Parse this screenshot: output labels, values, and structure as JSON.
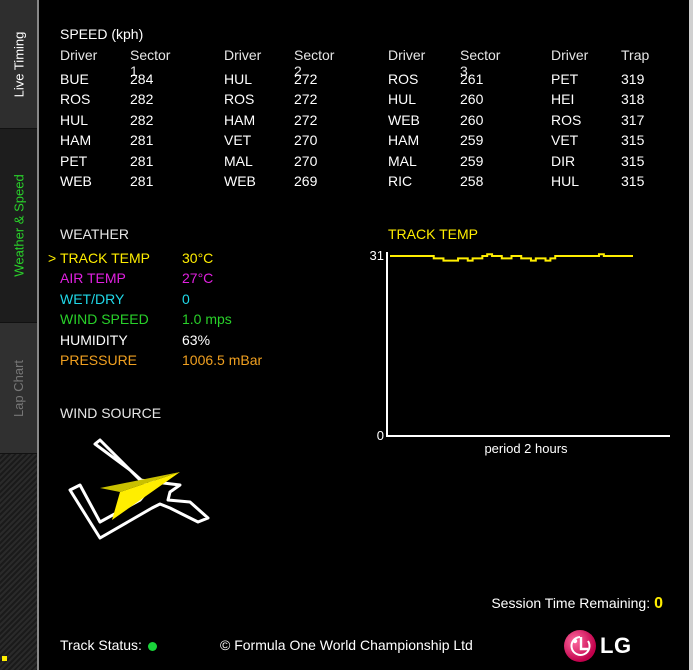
{
  "sidebar": {
    "tabs": [
      {
        "label": "Live Timing"
      },
      {
        "label": "Weather & Speed"
      },
      {
        "label": "Lap Chart"
      }
    ]
  },
  "speed": {
    "title": "SPEED (kph)",
    "groups": [
      {
        "driver_header": "Driver",
        "value_header": "Sector 1",
        "rows": [
          [
            "BUE",
            "284"
          ],
          [
            "ROS",
            "282"
          ],
          [
            "HUL",
            "282"
          ],
          [
            "HAM",
            "281"
          ],
          [
            "PET",
            "281"
          ],
          [
            "WEB",
            "281"
          ]
        ]
      },
      {
        "driver_header": "Driver",
        "value_header": "Sector 2",
        "rows": [
          [
            "HUL",
            "272"
          ],
          [
            "ROS",
            "272"
          ],
          [
            "HAM",
            "272"
          ],
          [
            "VET",
            "270"
          ],
          [
            "MAL",
            "270"
          ],
          [
            "WEB",
            "269"
          ]
        ]
      },
      {
        "driver_header": "Driver",
        "value_header": "Sector 3",
        "rows": [
          [
            "ROS",
            "261"
          ],
          [
            "HUL",
            "260"
          ],
          [
            "WEB",
            "260"
          ],
          [
            "HAM",
            "259"
          ],
          [
            "MAL",
            "259"
          ],
          [
            "RIC",
            "258"
          ]
        ]
      },
      {
        "driver_header": "Driver",
        "value_header": "Trap",
        "rows": [
          [
            "PET",
            "319"
          ],
          [
            "HEI",
            "318"
          ],
          [
            "ROS",
            "317"
          ],
          [
            "VET",
            "315"
          ],
          [
            "DIR",
            "315"
          ],
          [
            "HUL",
            "315"
          ]
        ]
      }
    ]
  },
  "weather": {
    "title": "WEATHER",
    "selected_marker": ">",
    "rows": [
      {
        "label": "TRACK TEMP",
        "value": "30°C",
        "color": "#ffee00"
      },
      {
        "label": "AIR TEMP",
        "value": "27°C",
        "color": "#e020e0"
      },
      {
        "label": "WET/DRY",
        "value": "0",
        "color": "#20d8e8"
      },
      {
        "label": "WIND SPEED",
        "value": "1.0 mps",
        "color": "#29d12a"
      },
      {
        "label": "HUMIDITY",
        "value": "63%",
        "color": "#ffffff"
      },
      {
        "label": "PRESSURE",
        "value": "1006.5 mBar",
        "color": "#f0a020"
      }
    ],
    "wind_title": "WIND SOURCE"
  },
  "track_chart": {
    "title": "TRACK TEMP",
    "y_max_label": "31",
    "y_min_label": "0",
    "x_caption": "period 2 hours"
  },
  "chart_data": {
    "type": "line",
    "title": "TRACK TEMP",
    "xlabel": "period 2 hours",
    "ylim": [
      0,
      31
    ],
    "x": [
      0,
      6,
      12,
      17,
      18,
      20,
      22,
      26,
      28,
      30,
      32,
      34,
      36,
      38,
      40,
      42,
      44,
      46,
      48,
      50,
      52,
      54,
      56,
      58,
      60,
      62,
      64,
      66,
      68,
      70,
      72,
      74,
      76,
      80,
      84,
      86,
      88,
      90,
      95,
      100
    ],
    "series": [
      {
        "values": [
          31,
          31,
          31,
          31,
          30.6,
          30.6,
          30.2,
          30.2,
          30.6,
          30.6,
          30.2,
          30.6,
          30.6,
          31,
          31.3,
          31,
          31,
          30.6,
          30.6,
          31,
          31,
          30.6,
          30.6,
          30.2,
          30.6,
          30.6,
          30.2,
          30.6,
          31,
          31,
          31,
          31,
          31,
          31,
          31,
          31.3,
          31,
          31,
          31,
          31
        ]
      }
    ]
  },
  "footer": {
    "session_label": "Session Time Remaining:",
    "session_value": "0",
    "track_status_label": "Track Status:",
    "copyright": "© Formula One World Championship Ltd",
    "logo_text": "LG"
  },
  "colors": {
    "accent_yellow": "#ffee00",
    "active_tab_green": "#29d12a",
    "status_green": "#19d33a"
  }
}
